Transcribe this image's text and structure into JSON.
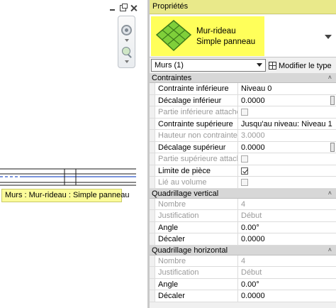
{
  "tooltip": "Murs : Mur-rideau : Simple panneau",
  "palette": {
    "title": "Propriétés",
    "type_name_line1": "Mur-rideau",
    "type_name_line2": "Simple panneau",
    "instance_selector": "Murs (1)",
    "edit_type_label": "Modifier le type"
  },
  "sections": [
    {
      "title": "Contraintes",
      "rows": [
        {
          "name": "Contrainte inférieure",
          "value": "Niveau 0",
          "disabled": false,
          "handle": false
        },
        {
          "name": "Décalage inférieur",
          "value": "0.0000",
          "disabled": false,
          "handle": true
        },
        {
          "name": "Partie inférieure attachée",
          "value": "",
          "checkbox": "off",
          "disabled": true
        },
        {
          "name": "Contrainte supérieure",
          "value": "Jusqu'au niveau: Niveau 1",
          "disabled": false
        },
        {
          "name": "Hauteur non contrainte",
          "value": "3.0000",
          "disabled": true
        },
        {
          "name": "Décalage supérieur",
          "value": "0.0000",
          "disabled": false,
          "handle": true
        },
        {
          "name": "Partie supérieure attachée",
          "value": "",
          "checkbox": "off",
          "disabled": true
        },
        {
          "name": "Limite de pièce",
          "value": "",
          "checkbox": "on",
          "disabled": false
        },
        {
          "name": "Lié au volume",
          "value": "",
          "checkbox": "off",
          "disabled": true
        }
      ]
    },
    {
      "title": "Quadrillage vertical",
      "rows": [
        {
          "name": "Nombre",
          "value": "4",
          "disabled": true
        },
        {
          "name": "Justification",
          "value": "Début",
          "disabled": true
        },
        {
          "name": "Angle",
          "value": "0.00°",
          "disabled": false
        },
        {
          "name": "Décaler",
          "value": "0.0000",
          "disabled": false
        }
      ]
    },
    {
      "title": "Quadrillage horizontal",
      "rows": [
        {
          "name": "Nombre",
          "value": "4",
          "disabled": true
        },
        {
          "name": "Justification",
          "value": "Début",
          "disabled": true
        },
        {
          "name": "Angle",
          "value": "0.00°",
          "disabled": false
        },
        {
          "name": "Décaler",
          "value": "0.0000",
          "disabled": false
        }
      ]
    }
  ],
  "colors": {
    "highlight": "#ffff5a",
    "title_bar": "#e9e98a",
    "type_icon_green": "#7fcf3a"
  },
  "icons": [
    "minimize-icon",
    "restore-icon",
    "close-icon",
    "steering-wheel-icon",
    "zoom-icon",
    "curtain-wall-type-icon",
    "edit-type-icon",
    "collapse-icon"
  ]
}
